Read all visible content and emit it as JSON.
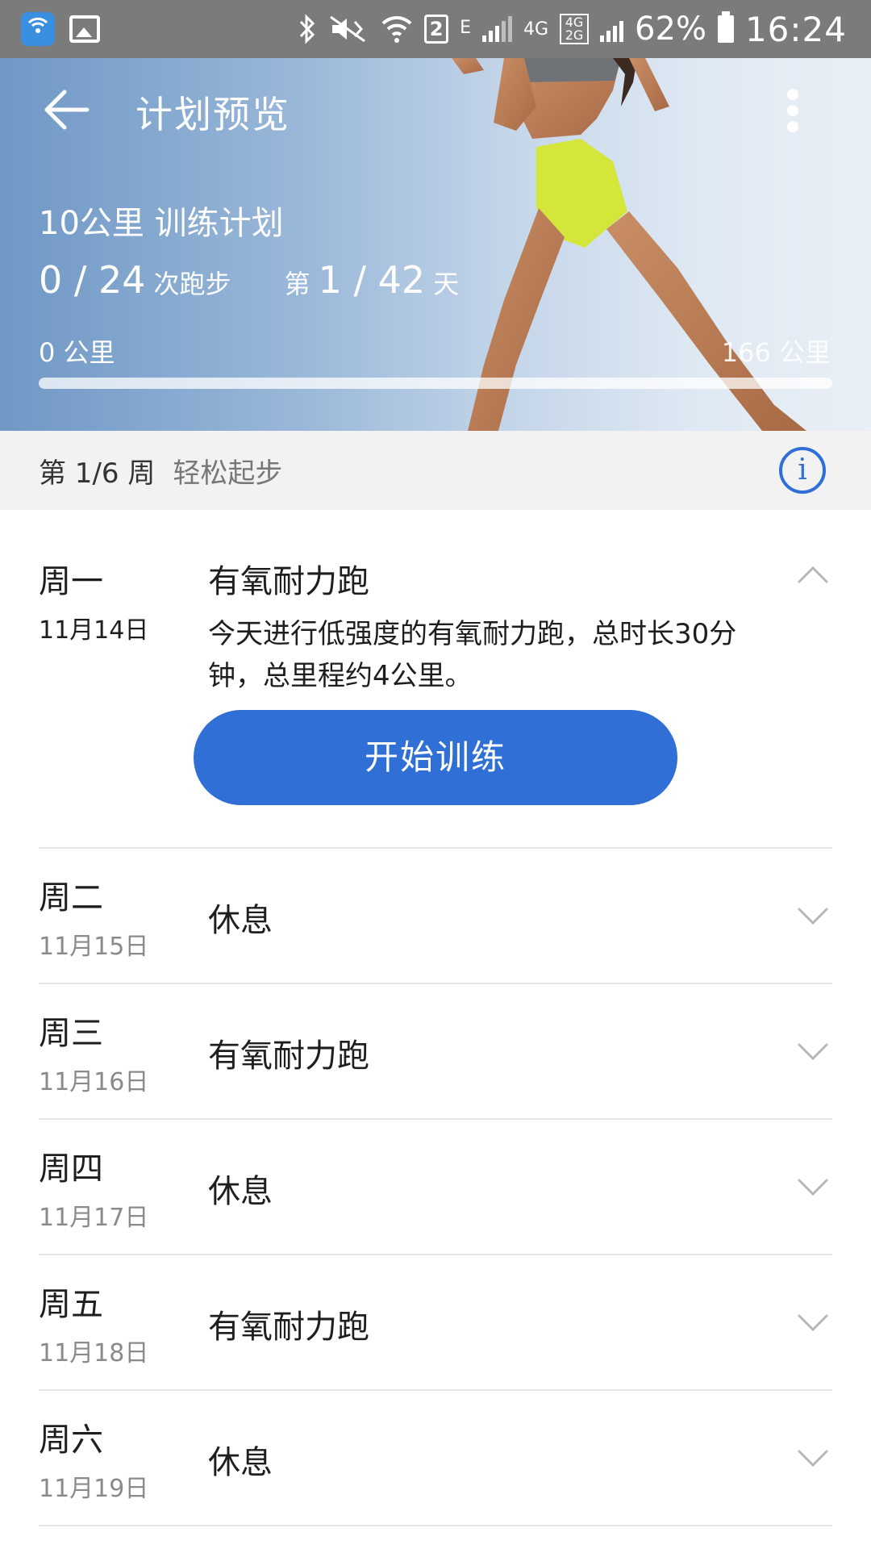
{
  "status_bar": {
    "lte_label": "E",
    "net_4g": "4G",
    "net_4g_2g": "4G 2G",
    "sim_badge": "2",
    "battery_pct": "62%",
    "clock": "16:24",
    "icons": [
      "wifi-hotspot-app-icon",
      "image-icon",
      "bluetooth-icon",
      "mute-icon",
      "wifi-icon",
      "signal-icon",
      "battery-icon"
    ]
  },
  "header": {
    "title": "计划预览",
    "back_icon": "arrow-left-icon",
    "more_icon": "more-vertical-icon"
  },
  "plan": {
    "title": "10公里 训练计划",
    "runs_done": "0 / 24",
    "runs_unit": "次跑步",
    "day_prefix": "第",
    "day_progress": "1 / 42",
    "day_unit": "天",
    "km_start": "0 公里",
    "km_total": "166 公里",
    "progress_fraction": 0
  },
  "week": {
    "label": "第 1/6 周",
    "name": "轻松起步",
    "info_icon": "info-icon",
    "info_glyph": "i"
  },
  "days": [
    {
      "weekday": "周一",
      "date": "11月14日",
      "activity": "有氧耐力跑",
      "expanded": true,
      "description": "今天进行低强度的有氧耐力跑，总时长30分钟，总里程约4公里。",
      "button": "开始训练"
    },
    {
      "weekday": "周二",
      "date": "11月15日",
      "activity": "休息",
      "expanded": false
    },
    {
      "weekday": "周三",
      "date": "11月16日",
      "activity": "有氧耐力跑",
      "expanded": false
    },
    {
      "weekday": "周四",
      "date": "11月17日",
      "activity": "休息",
      "expanded": false
    },
    {
      "weekday": "周五",
      "date": "11月18日",
      "activity": "有氧耐力跑",
      "expanded": false
    },
    {
      "weekday": "周六",
      "date": "11月19日",
      "activity": "休息",
      "expanded": false
    }
  ],
  "colors": {
    "accent": "#2f6fd6",
    "status_bar": "#7b7b7b",
    "week_bar": "#f2f2f2",
    "date_gray": "#8a8a8a"
  }
}
